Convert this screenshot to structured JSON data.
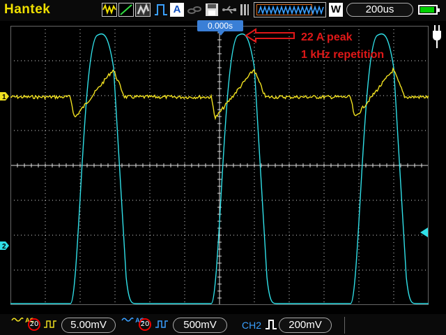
{
  "header": {
    "brand": "Hantek",
    "run_mode_badge": "W",
    "timebase": "200us",
    "auto_label": "A",
    "icons": [
      "acquire-mode-icon",
      "ramp-icon",
      "display-persist-icon",
      "pulse-icon",
      "auto-icon",
      "link-icon",
      "save-icon",
      "usb-icon",
      "memory-wave-icon",
      "battery-icon",
      "power-plug-icon"
    ]
  },
  "trigger": {
    "time_offset": "0.000s"
  },
  "annotation": {
    "line1": "22 A peak",
    "line2": "1 kHz repetition",
    "color": "#e01818"
  },
  "channels": {
    "ch1": {
      "marker": "1",
      "color": "#f0e020"
    },
    "ch2": {
      "marker": "2",
      "color": "#30e0e8"
    }
  },
  "footer": {
    "ch1": {
      "coupling": "AC",
      "bw_limit": "20",
      "scale": "5.00mV"
    },
    "ch2": {
      "coupling": "AC",
      "bw_limit": "20",
      "scale": "500mV"
    },
    "trigger": {
      "source": "CH2",
      "level": "200mV"
    }
  }
}
